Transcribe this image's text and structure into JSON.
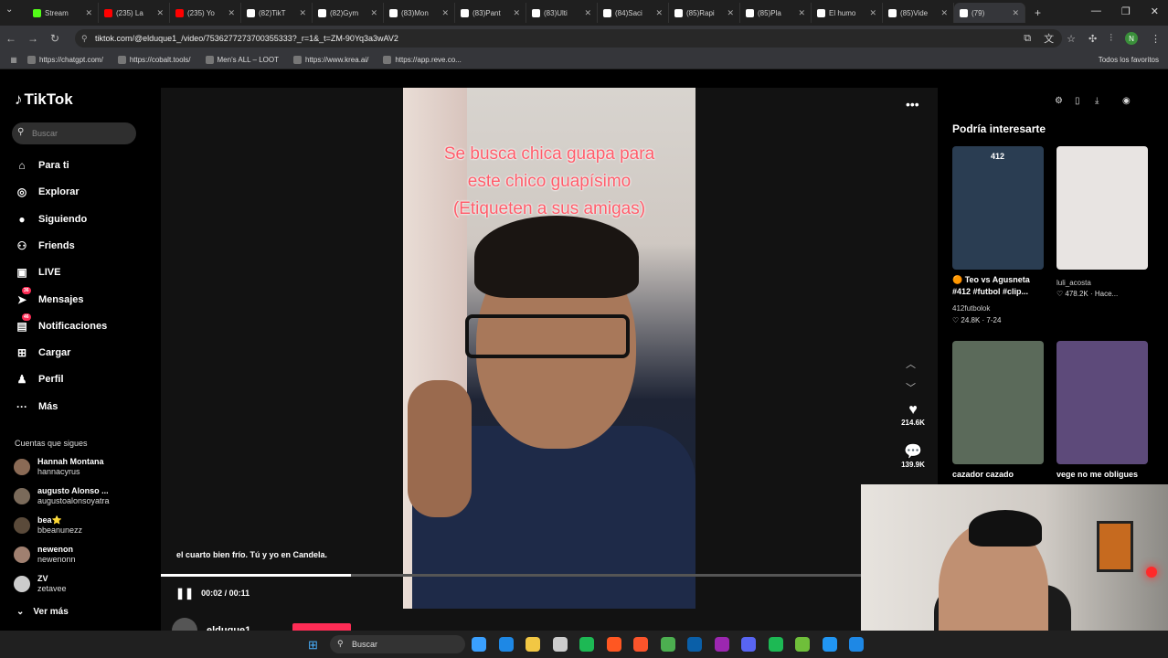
{
  "browser": {
    "tabs": [
      {
        "label": "Stream",
        "color": "#53fc18"
      },
      {
        "label": "(235) La",
        "color": "#ff0000"
      },
      {
        "label": "(235) Yo",
        "color": "#ff0000"
      },
      {
        "label": "(82)TikT",
        "color": "#ffffff"
      },
      {
        "label": "(82)Gym",
        "color": "#ffffff"
      },
      {
        "label": "(83)Mon",
        "color": "#ffffff"
      },
      {
        "label": "(83)Pant",
        "color": "#ffffff"
      },
      {
        "label": "(83)Ulti",
        "color": "#ffffff"
      },
      {
        "label": "(84)Saci",
        "color": "#ffffff"
      },
      {
        "label": "(85)Rapi",
        "color": "#ffffff"
      },
      {
        "label": "(85)Pla",
        "color": "#ffffff"
      },
      {
        "label": "El humo",
        "color": "#ffffff"
      },
      {
        "label": "(85)Vide",
        "color": "#ffffff"
      },
      {
        "label": "(79)",
        "color": "#ffffff"
      }
    ],
    "url": "tiktok.com/@elduque1_/video/7536277273700355333?_r=1&_t=ZM-90Yq3a3wAV2",
    "profile_initial": "N",
    "bookmarks": [
      "https://chatgpt.com/",
      "https://cobalt.tools/",
      "Men's ALL – LOOT",
      "https://www.krea.ai/",
      "https://app.reve.co..."
    ],
    "bookmarks_right": "Todos los favoritos"
  },
  "sidebar": {
    "logo": "TikTok",
    "search_placeholder": "Buscar",
    "nav": [
      {
        "label": "Para ti",
        "icon": "home-icon",
        "glyph": "⌂",
        "badge": ""
      },
      {
        "label": "Explorar",
        "icon": "compass-icon",
        "glyph": "◎",
        "badge": ""
      },
      {
        "label": "Siguiendo",
        "icon": "following-icon",
        "glyph": "●",
        "badge": ""
      },
      {
        "label": "Friends",
        "icon": "friends-icon",
        "glyph": "⚇",
        "badge": ""
      },
      {
        "label": "LIVE",
        "icon": "live-icon",
        "glyph": "▣",
        "badge": ""
      },
      {
        "label": "Mensajes",
        "icon": "messages-icon",
        "glyph": "➤",
        "badge": "36"
      },
      {
        "label": "Notificaciones",
        "icon": "notifications-icon",
        "glyph": "▤",
        "badge": "46"
      },
      {
        "label": "Cargar",
        "icon": "upload-icon",
        "glyph": "⊞",
        "badge": ""
      },
      {
        "label": "Perfil",
        "icon": "profile-icon",
        "glyph": "♟",
        "badge": ""
      },
      {
        "label": "Más",
        "icon": "more-icon",
        "glyph": "···",
        "badge": ""
      }
    ],
    "following_title": "Cuentas que sigues",
    "accounts": [
      {
        "name": "Hannah Montana",
        "handle": "hannacyrus"
      },
      {
        "name": "augusto Alonso ...",
        "handle": "augustoalonsoyatra"
      },
      {
        "name": "bea⭐",
        "handle": "bbeanunezz"
      },
      {
        "name": "newenon",
        "handle": "newenonn"
      },
      {
        "name": "ZV",
        "handle": "zetavee"
      }
    ],
    "see_more": "Ver más"
  },
  "player": {
    "overlay_text": [
      "Se busca chica guapa para",
      "este chico guapísimo",
      "(Etiqueten a sus amigas)"
    ],
    "caption": "el cuarto bien frío. Tú y yo en Candela.",
    "time": "00:02 / 00:11",
    "progress_fraction": 0.27,
    "author": "elduque1_",
    "likes": "214.6K",
    "comments": "139.9K"
  },
  "suggestions": {
    "title": "Podría interesarte",
    "items": [
      {
        "title": "🟠 Teo vs Agusneta #412 #futbol #clip...",
        "user": "412futbolok",
        "stats": "♡ 24.8K · 7-24",
        "thumb": "#2a3d52",
        "thumb_text": "412"
      },
      {
        "title": "",
        "user": "luli_acosta",
        "stats": "♡ 478.2K · Hace...",
        "thumb": "#e8e4e2",
        "thumb_text": ""
      },
      {
        "title": "cazador cazado",
        "user": "",
        "stats": "",
        "thumb": "#5b6a5a",
        "thumb_text": ""
      },
      {
        "title": "vege no me obligues",
        "user": "",
        "stats": "",
        "thumb": "#5d4a7a",
        "thumb_text": ""
      }
    ]
  },
  "taskbar": {
    "search_placeholder": "Buscar",
    "apps": [
      "#3aa0ff",
      "#1e88e5",
      "#f2c744",
      "#cccccc",
      "#1db954",
      "#ff5722",
      "#fb542b",
      "#4caf50",
      "#0a5fa8",
      "#9c27b0",
      "#5865f2",
      "#1db954",
      "#6fbf3a",
      "#2196f3",
      "#1e88e5"
    ]
  }
}
